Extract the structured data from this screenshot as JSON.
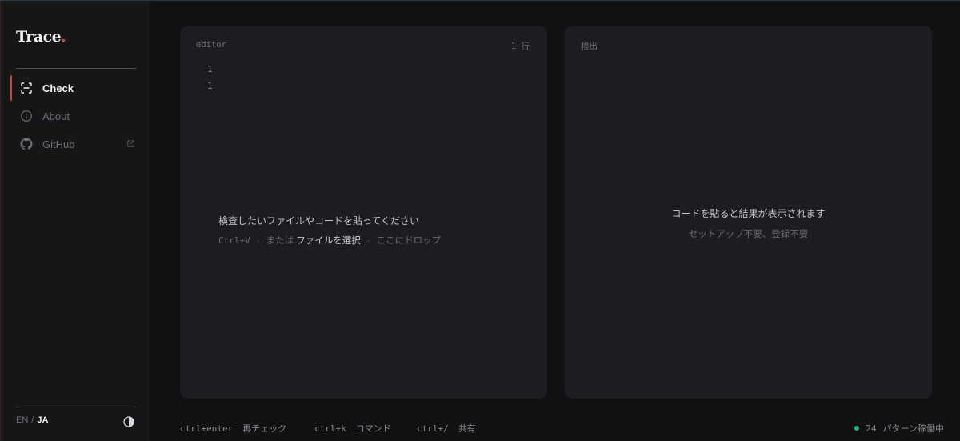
{
  "brand": {
    "name": "Trace",
    "dot": "."
  },
  "sidebar": {
    "items": [
      {
        "label": "Check",
        "icon": "scan-icon",
        "active": true
      },
      {
        "label": "About",
        "icon": "info-icon",
        "active": false
      },
      {
        "label": "GitHub",
        "icon": "github-icon",
        "active": false,
        "external": true
      }
    ],
    "lang": {
      "en": "EN",
      "sep": "/",
      "ja": "JA"
    }
  },
  "editor": {
    "label": "editor",
    "line_count": "1 行",
    "line_numbers": [
      "1",
      "1"
    ],
    "hint_title": "検査したいファイルやコードを貼ってください",
    "hint_paste": "Ctrl+V",
    "hint_dot": "·",
    "hint_or": "または",
    "hint_pick": "ファイルを選択",
    "hint_drop": "ここにドロップ"
  },
  "result": {
    "label": "検出",
    "title": "コードを貼ると結果が表示されます",
    "subtitle": "セットアップ不要、登録不要"
  },
  "footer": {
    "shortcuts": [
      {
        "key": "ctrl+enter",
        "action": "再チェック"
      },
      {
        "key": "ctrl+k",
        "action": "コマンド"
      },
      {
        "key": "ctrl+/",
        "action": "共有"
      }
    ],
    "status_count": "24",
    "status_text": "パターン稼働中"
  },
  "colors": {
    "accent": "#c8453c",
    "status_ok": "#2bb37a",
    "panel": "#1d1d1f",
    "sidebar": "#161617"
  }
}
